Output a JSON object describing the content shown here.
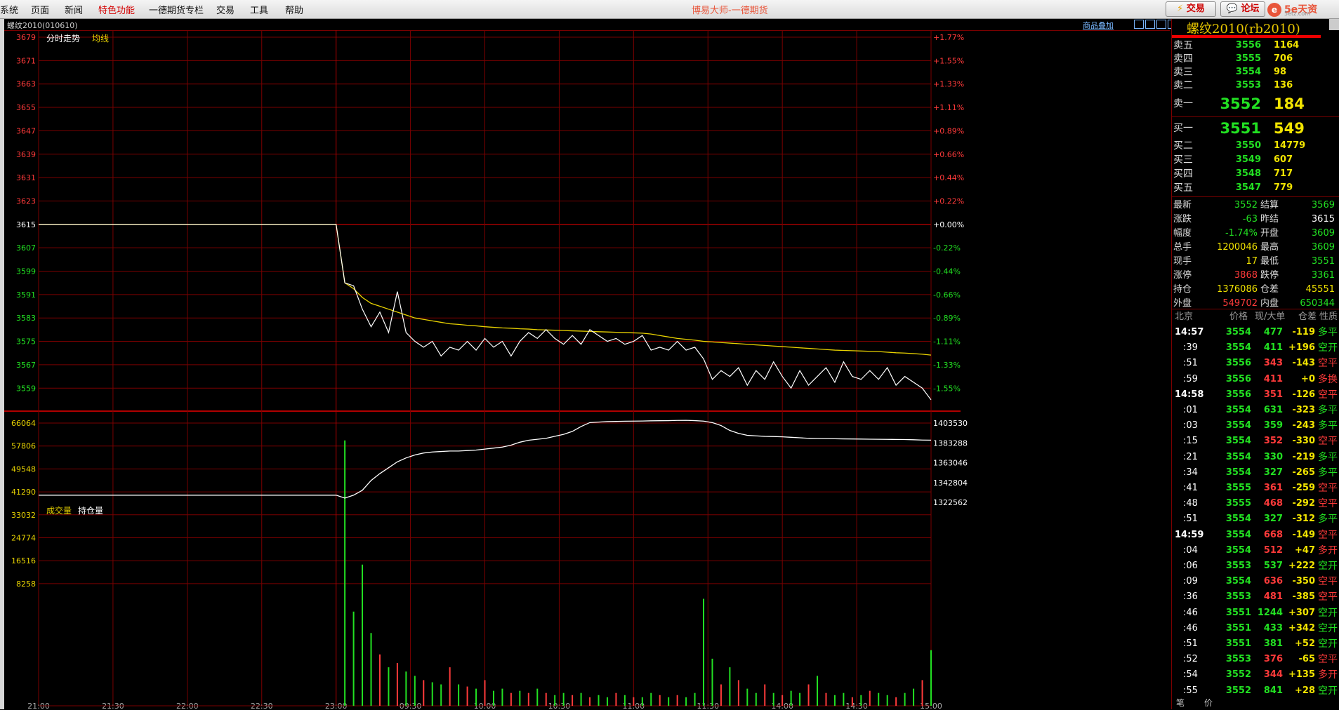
{
  "menu": [
    "系统",
    "页面",
    "新闻",
    "特色功能",
    "一德期货专栏",
    "交易",
    "工具",
    "帮助"
  ],
  "app_title": "博易大师-一德期货",
  "top_buttons": {
    "trade": "交易",
    "forum": "论坛"
  },
  "logo": {
    "mark": "e",
    "text": "5e天资",
    "sub": "5etz.com"
  },
  "symbol_title": "螺纹2010(010610)",
  "overlay_label": "商品叠加",
  "chart_tabs": {
    "intraday": "分时走势",
    "avg": "均线",
    "volume": "成交量",
    "oi": "持仓量"
  },
  "price_axis": {
    "prices": [
      "3679",
      "3671",
      "3663",
      "3655",
      "3647",
      "3639",
      "3631",
      "3623",
      "3615",
      "3607",
      "3599",
      "3591",
      "3583",
      "3575",
      "3567",
      "3559"
    ],
    "pcts": [
      "+1.77%",
      "+1.55%",
      "+1.33%",
      "+1.11%",
      "+0.89%",
      "+0.66%",
      "+0.44%",
      "+0.22%",
      "+0.00%",
      "-0.22%",
      "-0.44%",
      "-0.66%",
      "-0.89%",
      "-1.11%",
      "-1.33%",
      "-1.55%"
    ]
  },
  "vol_axis": {
    "left": [
      "66064",
      "57806",
      "49548",
      "41290",
      "33032",
      "24774",
      "16516",
      "8258"
    ],
    "right": [
      "1403530",
      "1383288",
      "1363046",
      "1342804",
      "1322562"
    ]
  },
  "time_axis": [
    "21:00",
    "21:30",
    "22:00",
    "22:30",
    "23:00",
    "09:30",
    "10:00",
    "10:30",
    "11:00",
    "11:30",
    "14:00",
    "14:30",
    "15:00"
  ],
  "colors": {
    "up": "#ff3a3a",
    "down": "#22e022",
    "grid": "#7a0000",
    "price_line": "#ffffff",
    "avg_line": "#e8d200"
  },
  "quote_title": "螺纹2010(rb2010)",
  "order_book": {
    "asks": [
      {
        "label": "卖五",
        "price": "3556",
        "vol": "1164"
      },
      {
        "label": "卖四",
        "price": "3555",
        "vol": "706"
      },
      {
        "label": "卖三",
        "price": "3554",
        "vol": "98"
      },
      {
        "label": "卖二",
        "price": "3553",
        "vol": "136"
      },
      {
        "label": "卖一",
        "price": "3552",
        "vol": "184"
      }
    ],
    "bids": [
      {
        "label": "买一",
        "price": "3551",
        "vol": "549"
      },
      {
        "label": "买二",
        "price": "3550",
        "vol": "14779"
      },
      {
        "label": "买三",
        "price": "3549",
        "vol": "607"
      },
      {
        "label": "买四",
        "price": "3548",
        "vol": "717"
      },
      {
        "label": "买五",
        "price": "3547",
        "vol": "779"
      }
    ]
  },
  "stats": [
    {
      "l1": "最新",
      "v1": "3552",
      "c1": "g",
      "l2": "结算",
      "v2": "3569",
      "c2": "g"
    },
    {
      "l1": "涨跌",
      "v1": "-63",
      "c1": "g",
      "l2": "昨结",
      "v2": "3615",
      "c2": "w"
    },
    {
      "l1": "幅度",
      "v1": "-1.74%",
      "c1": "g",
      "l2": "开盘",
      "v2": "3609",
      "c2": "g"
    },
    {
      "l1": "总手",
      "v1": "1200046",
      "c1": "y",
      "l2": "最高",
      "v2": "3609",
      "c2": "g"
    },
    {
      "l1": "现手",
      "v1": "17",
      "c1": "y",
      "l2": "最低",
      "v2": "3551",
      "c2": "g"
    },
    {
      "l1": "涨停",
      "v1": "3868",
      "c1": "r",
      "l2": "跌停",
      "v2": "3361",
      "c2": "g"
    },
    {
      "l1": "持仓",
      "v1": "1376086",
      "c1": "y",
      "l2": "仓差",
      "v2": "45551",
      "c2": "y"
    },
    {
      "l1": "外盘",
      "v1": "549702",
      "c1": "r",
      "l2": "内盘",
      "v2": "650344",
      "c2": "g"
    }
  ],
  "ticks_header": {
    "time": "北京",
    "price": "价格",
    "vol": "现/大单",
    "diff": "仓差",
    "nature": "性质"
  },
  "ticks": [
    {
      "t": "14:57",
      "p": "3554",
      "v": "477",
      "d": "-119",
      "n": "多平",
      "pc": "g",
      "vc": "g",
      "dc": "y",
      "nc": "g"
    },
    {
      "t": ":39",
      "p": "3554",
      "v": "411",
      "d": "+196",
      "n": "空开",
      "pc": "g",
      "vc": "g",
      "dc": "y",
      "nc": "g"
    },
    {
      "t": ":51",
      "p": "3556",
      "v": "343",
      "d": "-143",
      "n": "空平",
      "pc": "g",
      "vc": "r",
      "dc": "y",
      "nc": "r"
    },
    {
      "t": ":59",
      "p": "3556",
      "v": "411",
      "d": "+0",
      "n": "多换",
      "pc": "g",
      "vc": "r",
      "dc": "y",
      "nc": "r"
    },
    {
      "t": "14:58",
      "p": "3556",
      "v": "351",
      "d": "-126",
      "n": "空平",
      "pc": "g",
      "vc": "r",
      "dc": "y",
      "nc": "r"
    },
    {
      "t": ":01",
      "p": "3554",
      "v": "631",
      "d": "-323",
      "n": "多平",
      "pc": "g",
      "vc": "g",
      "dc": "y",
      "nc": "g"
    },
    {
      "t": ":03",
      "p": "3554",
      "v": "359",
      "d": "-243",
      "n": "多平",
      "pc": "g",
      "vc": "g",
      "dc": "y",
      "nc": "g"
    },
    {
      "t": ":15",
      "p": "3554",
      "v": "352",
      "d": "-330",
      "n": "空平",
      "pc": "g",
      "vc": "r",
      "dc": "y",
      "nc": "r"
    },
    {
      "t": ":21",
      "p": "3554",
      "v": "330",
      "d": "-219",
      "n": "多平",
      "pc": "g",
      "vc": "g",
      "dc": "y",
      "nc": "g"
    },
    {
      "t": ":34",
      "p": "3554",
      "v": "327",
      "d": "-265",
      "n": "多平",
      "pc": "g",
      "vc": "g",
      "dc": "y",
      "nc": "g"
    },
    {
      "t": ":41",
      "p": "3555",
      "v": "361",
      "d": "-259",
      "n": "空平",
      "pc": "g",
      "vc": "r",
      "dc": "y",
      "nc": "r"
    },
    {
      "t": ":48",
      "p": "3555",
      "v": "468",
      "d": "-292",
      "n": "空平",
      "pc": "g",
      "vc": "r",
      "dc": "y",
      "nc": "r"
    },
    {
      "t": ":51",
      "p": "3554",
      "v": "327",
      "d": "-312",
      "n": "多平",
      "pc": "g",
      "vc": "g",
      "dc": "y",
      "nc": "g"
    },
    {
      "t": "14:59",
      "p": "3554",
      "v": "668",
      "d": "-149",
      "n": "空平",
      "pc": "g",
      "vc": "r",
      "dc": "y",
      "nc": "r"
    },
    {
      "t": ":04",
      "p": "3554",
      "v": "512",
      "d": "+47",
      "n": "多开",
      "pc": "g",
      "vc": "r",
      "dc": "y",
      "nc": "r"
    },
    {
      "t": ":06",
      "p": "3553",
      "v": "537",
      "d": "+222",
      "n": "空开",
      "pc": "g",
      "vc": "g",
      "dc": "y",
      "nc": "g"
    },
    {
      "t": ":09",
      "p": "3554",
      "v": "636",
      "d": "-350",
      "n": "空平",
      "pc": "g",
      "vc": "r",
      "dc": "y",
      "nc": "r"
    },
    {
      "t": ":36",
      "p": "3553",
      "v": "481",
      "d": "-385",
      "n": "空平",
      "pc": "g",
      "vc": "r",
      "dc": "y",
      "nc": "r"
    },
    {
      "t": ":46",
      "p": "3551",
      "v": "1244",
      "d": "+307",
      "n": "空开",
      "pc": "g",
      "vc": "g",
      "dc": "y",
      "nc": "g"
    },
    {
      "t": ":46",
      "p": "3551",
      "v": "433",
      "d": "+342",
      "n": "空开",
      "pc": "g",
      "vc": "g",
      "dc": "y",
      "nc": "g"
    },
    {
      "t": ":51",
      "p": "3551",
      "v": "381",
      "d": "+52",
      "n": "空开",
      "pc": "g",
      "vc": "g",
      "dc": "y",
      "nc": "g"
    },
    {
      "t": ":52",
      "p": "3553",
      "v": "376",
      "d": "-65",
      "n": "空平",
      "pc": "g",
      "vc": "r",
      "dc": "y",
      "nc": "r"
    },
    {
      "t": ":54",
      "p": "3552",
      "v": "344",
      "d": "+135",
      "n": "多开",
      "pc": "g",
      "vc": "r",
      "dc": "y",
      "nc": "r"
    },
    {
      "t": ":55",
      "p": "3552",
      "v": "841",
      "d": "+28",
      "n": "空开",
      "pc": "g",
      "vc": "g",
      "dc": "y",
      "nc": "g"
    }
  ],
  "bottom_tabs": [
    "笔",
    "价"
  ],
  "chart_data": {
    "type": "line",
    "y_range": [
      3555,
      3683
    ],
    "prev_settle": 3615,
    "price": [
      3615,
      3615,
      3615,
      3615,
      3615,
      3595,
      3594,
      3586,
      3580,
      3585,
      3578,
      3592,
      3578,
      3575,
      3573,
      3575,
      3570,
      3573,
      3572,
      3575,
      3572,
      3576,
      3573,
      3575,
      3570,
      3575,
      3578,
      3576,
      3579,
      3576,
      3574,
      3577,
      3574,
      3579,
      3577,
      3575,
      3576,
      3574,
      3575,
      3577,
      3572,
      3573,
      3572,
      3575,
      3572,
      3573,
      3569,
      3562,
      3565,
      3563,
      3566,
      3560,
      3565,
      3562,
      3568,
      3563,
      3559,
      3565,
      3560,
      3563,
      3566,
      3561,
      3568,
      3563,
      3562,
      3565,
      3562,
      3566,
      3560,
      3563,
      3561,
      3559,
      3555
    ],
    "avg": [
      3615,
      3615,
      3615,
      3615,
      3615,
      3595,
      3593,
      3590,
      3588,
      3587,
      3586,
      3585,
      3584,
      3583,
      3582.5,
      3582,
      3581.5,
      3581,
      3580.8,
      3580.5,
      3580.3,
      3580,
      3579.8,
      3579.6,
      3579.5,
      3579.3,
      3579.2,
      3579,
      3578.9,
      3578.8,
      3578.7,
      3578.6,
      3578.5,
      3578.4,
      3578.3,
      3578.2,
      3578.1,
      3578,
      3577.9,
      3577.8,
      3577.5,
      3577,
      3576.5,
      3576,
      3575.7,
      3575.4,
      3575,
      3574.8,
      3574.6,
      3574.4,
      3574.2,
      3574,
      3573.8,
      3573.6,
      3573.4,
      3573.2,
      3573,
      3572.8,
      3572.6,
      3572.4,
      3572.2,
      3572,
      3571.9,
      3571.8,
      3571.7,
      3571.6,
      3571.5,
      3571.3,
      3571.1,
      3571,
      3570.8,
      3570.6,
      3570.3
    ],
    "oi_range": [
      1302320,
      1423772
    ],
    "open_interest": [
      1330000,
      1330000,
      1330000,
      1330000,
      1330000,
      1327000,
      1330000,
      1335000,
      1345000,
      1352000,
      1358000,
      1364000,
      1368000,
      1371000,
      1373000,
      1374000,
      1374500,
      1375000,
      1375000,
      1375500,
      1376000,
      1377000,
      1378000,
      1379000,
      1381000,
      1384000,
      1386000,
      1387000,
      1388000,
      1390000,
      1392000,
      1395000,
      1400000,
      1404000,
      1404500,
      1405000,
      1405200,
      1405400,
      1405500,
      1405600,
      1405800,
      1405900,
      1406000,
      1406200,
      1406300,
      1406000,
      1405500,
      1404000,
      1401000,
      1396000,
      1393000,
      1391000,
      1390500,
      1390000,
      1389800,
      1389500,
      1389000,
      1388500,
      1388000,
      1387800,
      1387600,
      1387500,
      1387400,
      1387300,
      1387200,
      1387100,
      1387000,
      1386900,
      1386800,
      1386700,
      1386500,
      1386200,
      1386086
    ],
    "vol_max": 66064,
    "volume": [
      0,
      0,
      0,
      0,
      0,
      62000,
      22000,
      33000,
      17000,
      12000,
      9000,
      10000,
      8000,
      7000,
      6000,
      5500,
      5000,
      9000,
      5000,
      4500,
      4000,
      6000,
      3500,
      4000,
      3000,
      3500,
      3000,
      4000,
      3000,
      2500,
      3000,
      2500,
      3000,
      2000,
      2500,
      2000,
      3000,
      2500,
      2000,
      2000,
      3000,
      2500,
      2000,
      2500,
      2000,
      3000,
      25000,
      11000,
      5000,
      9000,
      6000,
      4000,
      3000,
      5000,
      3000,
      2500,
      3500,
      3000,
      5000,
      7000,
      3000,
      2500,
      3000,
      2000,
      2500,
      3500,
      3000,
      2500,
      2000,
      3000,
      4000,
      6000,
      13000
    ],
    "vol_colors": [
      0,
      0,
      0,
      0,
      0,
      1,
      1,
      1,
      1,
      0,
      1,
      0,
      1,
      1,
      0,
      1,
      1,
      0,
      1,
      0,
      1,
      0,
      1,
      1,
      0,
      1,
      0,
      1,
      0,
      1,
      1,
      0,
      1,
      0,
      1,
      1,
      0,
      1,
      0,
      1,
      1,
      0,
      1,
      0,
      1,
      1,
      1,
      1,
      0,
      1,
      0,
      1,
      1,
      0,
      1,
      0,
      1,
      1,
      0,
      1,
      0,
      1,
      1,
      0,
      1,
      0,
      1,
      1,
      0,
      1,
      1,
      0,
      1
    ]
  }
}
